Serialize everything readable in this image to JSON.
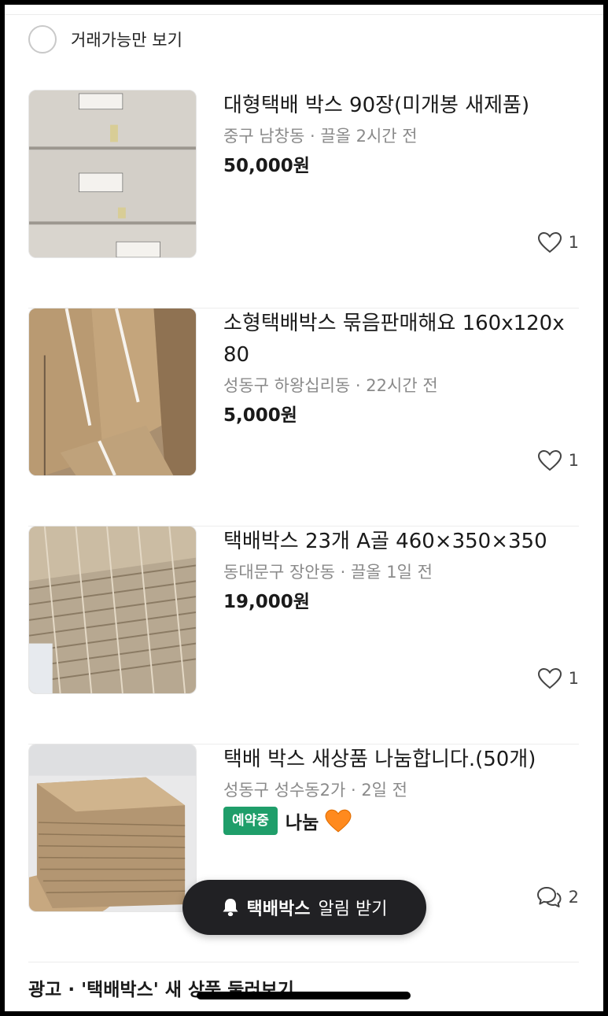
{
  "filter": {
    "label": "거래가능만 보기",
    "checked": false
  },
  "listings": [
    {
      "title": "대형택배 박스 90장(미개봉 새제품)",
      "location": "중구 남창동",
      "time": "끌올 2시간 전",
      "price": "50,000원",
      "stat_icon": "heart-icon",
      "stat_count": "1"
    },
    {
      "title": "소형택배박스 묶음판매해요 160x120x80",
      "location": "성동구 하왕십리동",
      "time": "22시간 전",
      "price": "5,000원",
      "stat_icon": "heart-icon",
      "stat_count": "1"
    },
    {
      "title": "택배박스 23개 A골 460×350×350",
      "location": "동대문구 장안동",
      "time": "끌올 1일 전",
      "price": "19,000원",
      "stat_icon": "heart-icon",
      "stat_count": "1"
    },
    {
      "title": "택배 박스 새상품 나눔합니다.(50개)",
      "location": "성동구 성수동2가",
      "time": "2일 전",
      "badge": "예약중",
      "price": "나눔",
      "stat_icon": "chat-icon",
      "stat_count": "2"
    }
  ],
  "separator": " · ",
  "alert_button": {
    "keyword": "택배박스",
    "suffix": "알림 받기",
    "icon": "bell-icon"
  },
  "ad_heading": "광고 · '택배박스' 새 상품 둘러보기",
  "colors": {
    "badge": "#1f9e6a",
    "pill": "#212124",
    "heart_emoji": "#ff8a1e"
  }
}
